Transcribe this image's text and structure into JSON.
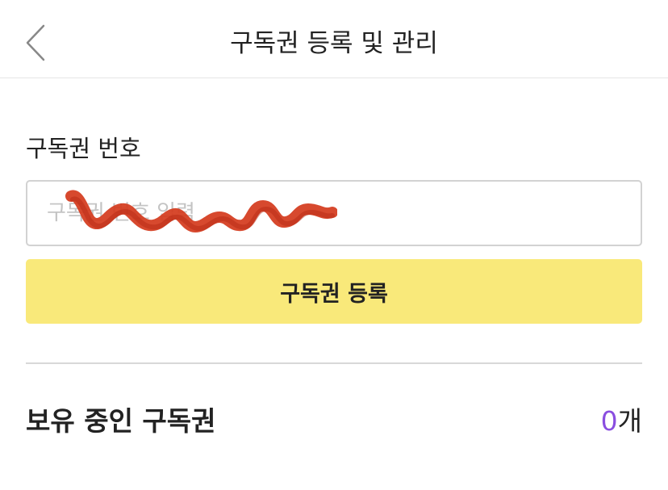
{
  "header": {
    "title": "구독권 등록 및 관리",
    "back_icon": "chevron-left-icon"
  },
  "form": {
    "label": "구독권 번호",
    "placeholder": "구독권 번호 입력",
    "value": "",
    "submit_label": "구독권 등록"
  },
  "owned": {
    "title": "보유 중인 구독권",
    "count": "0",
    "unit": "개"
  },
  "colors": {
    "accent_button": "#f9e97a",
    "count_highlight": "#8a4ee0",
    "redaction": "#d4391c"
  }
}
